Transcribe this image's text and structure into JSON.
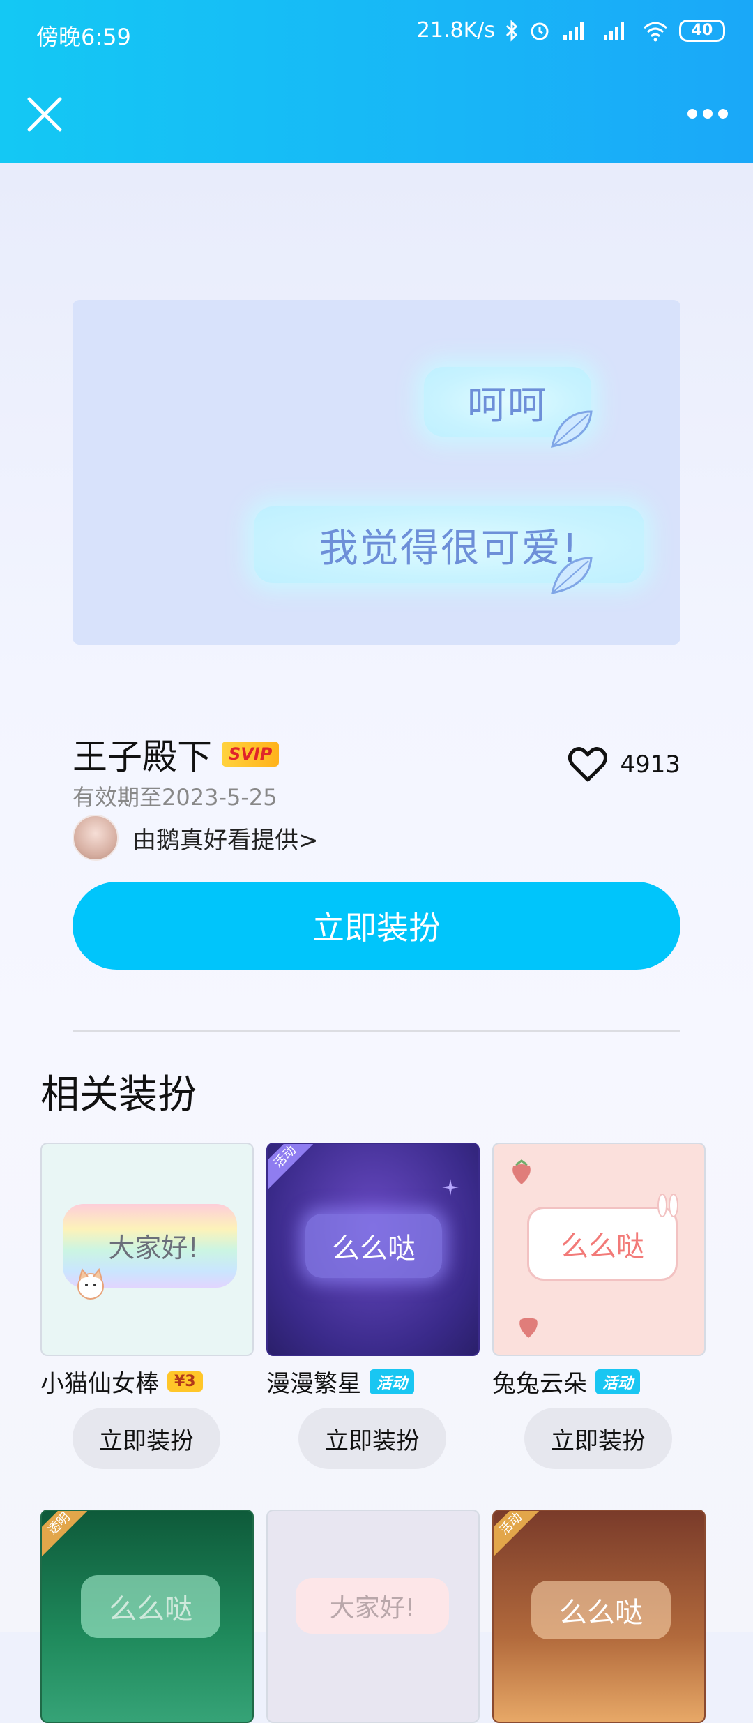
{
  "status_bar": {
    "time": "傍晚6:59",
    "net_speed": "21.8K/s",
    "battery": "40"
  },
  "header": {
    "close_icon": "close-icon",
    "more_icon": "more-icon"
  },
  "preview": {
    "bubble1": "呵呵",
    "bubble2": "我觉得很可爱!"
  },
  "item": {
    "title": "王子殿下",
    "badge": "SVIP",
    "validity": "有效期至2023-5-25",
    "likes": "4913",
    "provider": "由鹅真好看提供>",
    "apply_label": "立即装扮"
  },
  "related": {
    "title": "相关装扮",
    "items": [
      {
        "name": "小猫仙女棒",
        "badge": "¥3",
        "badge_type": "price",
        "bubble_text": "大家好!",
        "button": "立即装扮"
      },
      {
        "name": "漫漫繁星",
        "badge": "活动",
        "badge_type": "event",
        "bubble_text": "么么哒",
        "corner": "活动",
        "button": "立即装扮"
      },
      {
        "name": "兔兔云朵",
        "badge": "活动",
        "badge_type": "event",
        "bubble_text": "么么哒",
        "button": "立即装扮"
      }
    ],
    "row2": [
      {
        "bubble_text": "么么哒",
        "corner": "透明"
      },
      {
        "bubble_text": "大家好!"
      },
      {
        "bubble_text": "么么哒",
        "corner": "活动"
      }
    ]
  },
  "colors": {
    "accent": "#00c5fb",
    "header_start": "#14c8f4",
    "header_end": "#1aa8f8"
  }
}
